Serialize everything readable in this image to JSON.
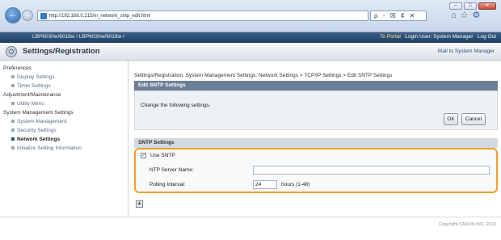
{
  "browser": {
    "url": "http://192.168.0.215/m_network_sntp_edit.html",
    "search_text": "ρ - ☒ ¢ ✕",
    "window_buttons": [
      "–",
      "□",
      "✕"
    ],
    "tool_icons": [
      "home-icon",
      "star-icon",
      "gear-icon"
    ]
  },
  "topbar": {
    "model": "LBP6030w/6018w / LBP6030w/6018w /",
    "portal_link": "To Portal",
    "login_text": "Login User: System Manager",
    "logout_link": "Log Out"
  },
  "title": {
    "text": "Settings/Registration",
    "mail_link": "Mail to System Manager"
  },
  "sidebar": {
    "groups": [
      {
        "label": "Preferences",
        "items": [
          {
            "label": "Display Settings",
            "active": false
          },
          {
            "label": "Timer Settings",
            "active": false
          }
        ]
      },
      {
        "label": "Adjustment/Maintenance",
        "items": [
          {
            "label": "Utility Menu",
            "active": false
          }
        ]
      },
      {
        "label": "System Management Settings",
        "items": [
          {
            "label": "System Management",
            "active": false
          },
          {
            "label": "Security Settings",
            "active": false
          },
          {
            "label": "Network Settings",
            "active": true
          },
          {
            "label": "Initialize Setting Information",
            "active": false
          }
        ]
      }
    ]
  },
  "main": {
    "breadcrumb": "Settings/Registration: System Management Settings: Network Settings > TCP/IP Settings > Edit SNTP Settings",
    "section_title": "Edit SNTP Settings",
    "note": "Change the following settings.",
    "ok_label": "OK",
    "cancel_label": "Cancel",
    "sntp_header": "SNTP Settings",
    "use_sntp_label": "Use SNTP",
    "use_sntp_checked": true,
    "ntp_server_label": "NTP Server Name:",
    "ntp_server_value": "",
    "polling_label": "Polling Interval:",
    "polling_value": "24",
    "polling_unit": "hours (1-48)",
    "highlight_color": "#f0a02a"
  },
  "footer": {
    "copyright": "Copyright CANON INC. 2013"
  }
}
